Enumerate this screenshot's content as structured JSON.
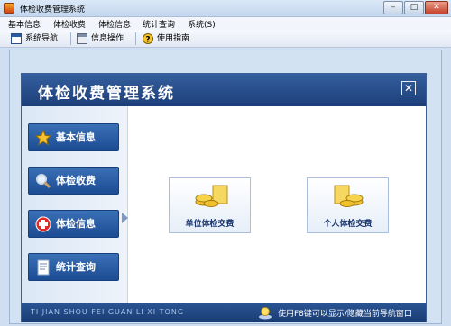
{
  "window": {
    "title": "体检收费管理系统",
    "minimize": "–",
    "maximize": "□",
    "close": "✕"
  },
  "menubar": {
    "items": [
      "基本信息",
      "体检收费",
      "体检信息",
      "统计查询",
      "系统(S)"
    ]
  },
  "toolbar": {
    "items": [
      {
        "label": "系统导航",
        "icon": "navigation-window-icon"
      },
      {
        "label": "信息操作",
        "icon": "info-window-icon"
      },
      {
        "label": "使用指南",
        "icon": "help-icon"
      }
    ]
  },
  "panel": {
    "title": "体检收费管理系统",
    "close": "✕"
  },
  "nav": {
    "items": [
      {
        "label": "基本信息",
        "icon": "star-icon"
      },
      {
        "label": "体检收费",
        "icon": "magnifier-icon"
      },
      {
        "label": "体检信息",
        "icon": "medical-cross-icon"
      },
      {
        "label": "统计查询",
        "icon": "document-icon"
      }
    ]
  },
  "content": {
    "actions": [
      {
        "label": "单位体检交费",
        "icon": "coins-icon"
      },
      {
        "label": "个人体检交费",
        "icon": "coins-icon"
      }
    ]
  },
  "footer": {
    "pinyin": "TI JIAN SHOU FEI GUAN LI XI TONG",
    "hint": "使用F8键可以显示/隐藏当前导航窗口"
  },
  "colors": {
    "panel_header": "#1d3f79",
    "nav_button": "#2c5fa8",
    "workspace": "#d3e2f3"
  }
}
